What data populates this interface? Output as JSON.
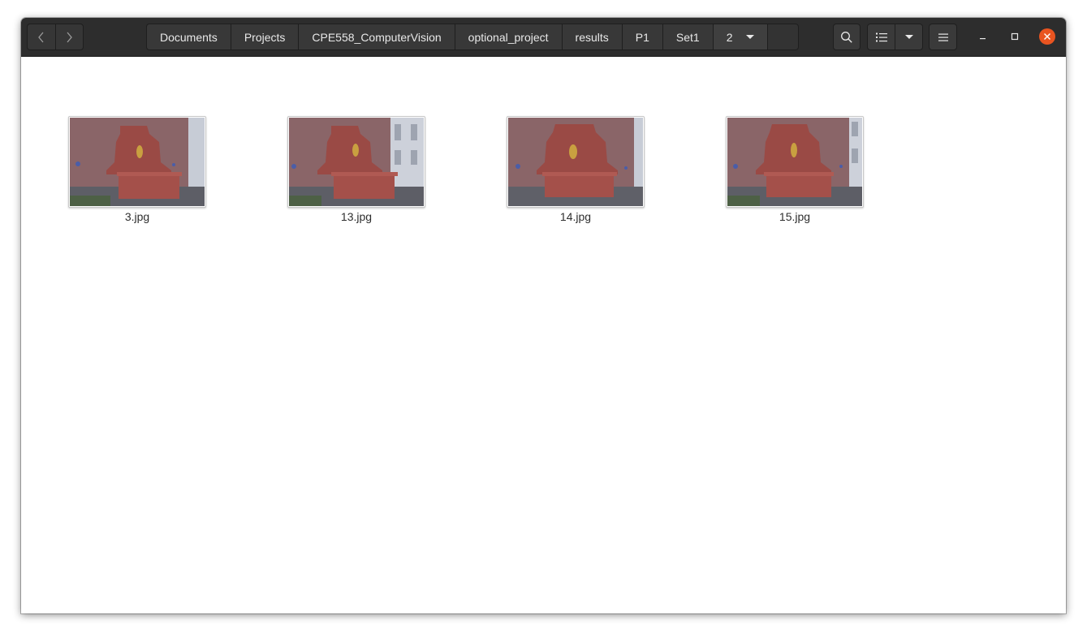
{
  "window": {
    "navigation": {
      "back_icon": "chevron-left-icon",
      "forward_icon": "chevron-right-icon"
    },
    "path": [
      "Documents",
      "Projects",
      "CPE558_ComputerVision",
      "optional_project",
      "results",
      "P1",
      "Set1",
      "2"
    ],
    "toolbar": {
      "search_icon": "search-icon",
      "view_icon": "list-view-icon",
      "view_options_icon": "chevron-down-icon",
      "menu_icon": "hamburger-menu-icon"
    },
    "window_controls": {
      "minimize_icon": "minimize-icon",
      "maximize_icon": "maximize-icon",
      "close_icon": "close-icon",
      "close_color": "#e95420"
    }
  },
  "files": [
    {
      "name": "3.jpg"
    },
    {
      "name": "13.jpg"
    },
    {
      "name": "14.jpg"
    },
    {
      "name": "15.jpg"
    }
  ]
}
